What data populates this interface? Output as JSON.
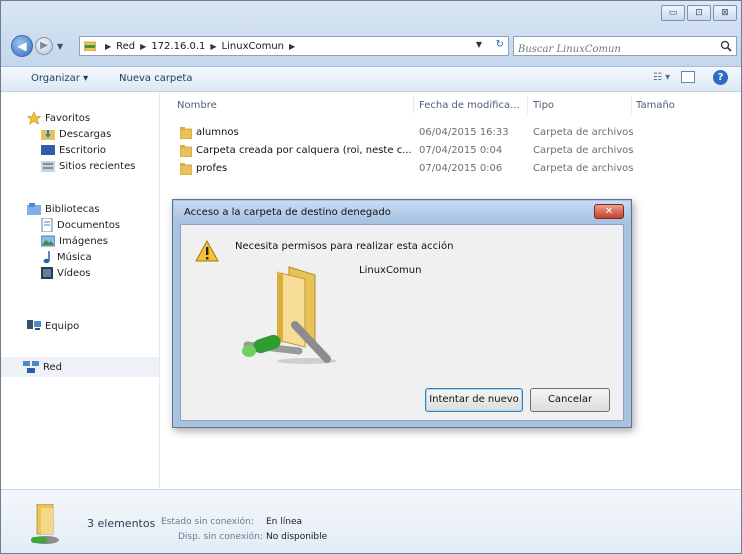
{
  "window": {
    "caption_buttons": [
      "▭",
      "⊡",
      "⊠"
    ]
  },
  "address": {
    "crumbs": [
      "Red",
      "172.16.0.1",
      "LinuxComun"
    ],
    "search_placeholder": "Buscar LinuxComun"
  },
  "toolbar": {
    "organize_label": "Organizar ▾",
    "new_folder_label": "Nueva carpeta"
  },
  "sidebar": {
    "favorites_label": "Favoritos",
    "favorites": [
      "Descargas",
      "Escritorio",
      "Sitios recientes"
    ],
    "libraries_label": "Bibliotecas",
    "libraries": [
      "Documentos",
      "Imágenes",
      "Música",
      "Vídeos"
    ],
    "computer_label": "Equipo",
    "network_label": "Red"
  },
  "columns": {
    "name": "Nombre",
    "date": "Fecha de modifica...",
    "type": "Tipo",
    "size": "Tamaño"
  },
  "files": [
    {
      "name": "alumnos",
      "date": "06/04/2015 16:33",
      "type": "Carpeta de archivos"
    },
    {
      "name": "Carpeta creada por calquera (roi, neste c...",
      "date": "07/04/2015 0:04",
      "type": "Carpeta de archivos"
    },
    {
      "name": "profes",
      "date": "07/04/2015 0:06",
      "type": "Carpeta de archivos"
    }
  ],
  "status": {
    "count": "3 elementos",
    "offline_state_label": "Estado sin conexión:",
    "offline_state_value": "En línea",
    "offline_avail_label": "Disp. sin conexión:",
    "offline_avail_value": "No disponible"
  },
  "dialog": {
    "title": "Acceso a la carpeta de destino denegado",
    "message": "Necesita permisos para realizar esta acción",
    "path": "LinuxComun",
    "retry_label": "Intentar de nuevo",
    "cancel_label": "Cancelar",
    "close_glyph": "✕"
  },
  "colors": {
    "folder": "#e9c25a",
    "warning": "#f2c230",
    "close_red": "#c4412a",
    "accent_blue": "#2e6bc4"
  }
}
